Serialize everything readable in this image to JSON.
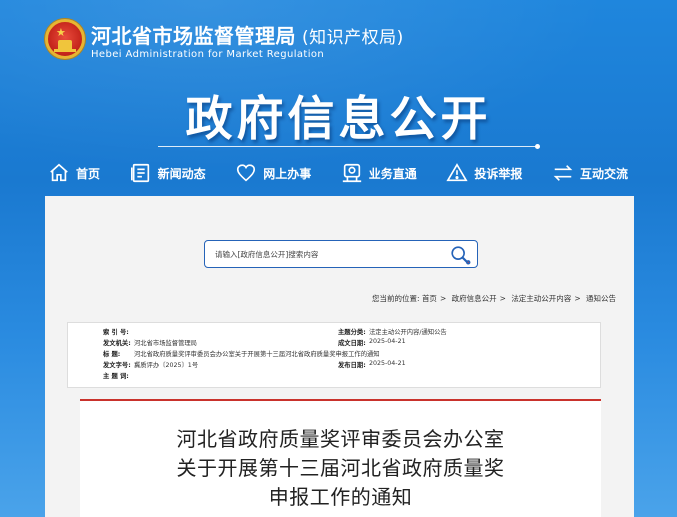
{
  "header": {
    "org_name_cn": "河北省市场监督管理局",
    "org_name_sub": "(知识产权局)",
    "org_name_en": "Hebei Administration for Market Regulation",
    "banner_title": "政府信息公开"
  },
  "nav": {
    "items": [
      {
        "label": "首页",
        "icon": "home-icon"
      },
      {
        "label": "新闻动态",
        "icon": "news-icon"
      },
      {
        "label": "网上办事",
        "icon": "heart-icon"
      },
      {
        "label": "业务直通",
        "icon": "service-icon"
      },
      {
        "label": "投诉举报",
        "icon": "warning-icon"
      },
      {
        "label": "互动交流",
        "icon": "exchange-icon"
      }
    ]
  },
  "search": {
    "placeholder": "请输入[政府信息公开]搜索内容",
    "icon": "search-icon"
  },
  "breadcrumb": {
    "prefix": "您当前的位置:",
    "items": [
      "首页",
      "政府信息公开",
      "法定主动公开内容",
      "通知公告"
    ],
    "separator": ">"
  },
  "meta": {
    "index_label": "索 引 号:",
    "index_value": "",
    "category_label": "主题分类:",
    "category_value": "法定主动公开内容/通知公告",
    "issuer_label": "发文机关:",
    "issuer_value": "河北省市场监督管理局",
    "created_label": "成文日期:",
    "created_value": "2025-04-21",
    "title_label": "标      题:",
    "title_value": "河北省政府质量奖评审委员会办公室关于开展第十三届河北省政府质量奖申报工作的通知",
    "docno_label": "发文字号:",
    "docno_value": "冀质评办〔2025〕1号",
    "published_label": "发布日期:",
    "published_value": "2025-04-21",
    "keywords_label": "主 题 词:",
    "keywords_value": ""
  },
  "document": {
    "title_line1": "河北省政府质量奖评审委员会办公室",
    "title_line2": "关于开展第十三届河北省政府质量奖",
    "title_line3": "申报工作的通知"
  },
  "colors": {
    "header_blue": "#1a7ad1",
    "accent_red": "#c9322c",
    "search_border": "#2563b8"
  }
}
